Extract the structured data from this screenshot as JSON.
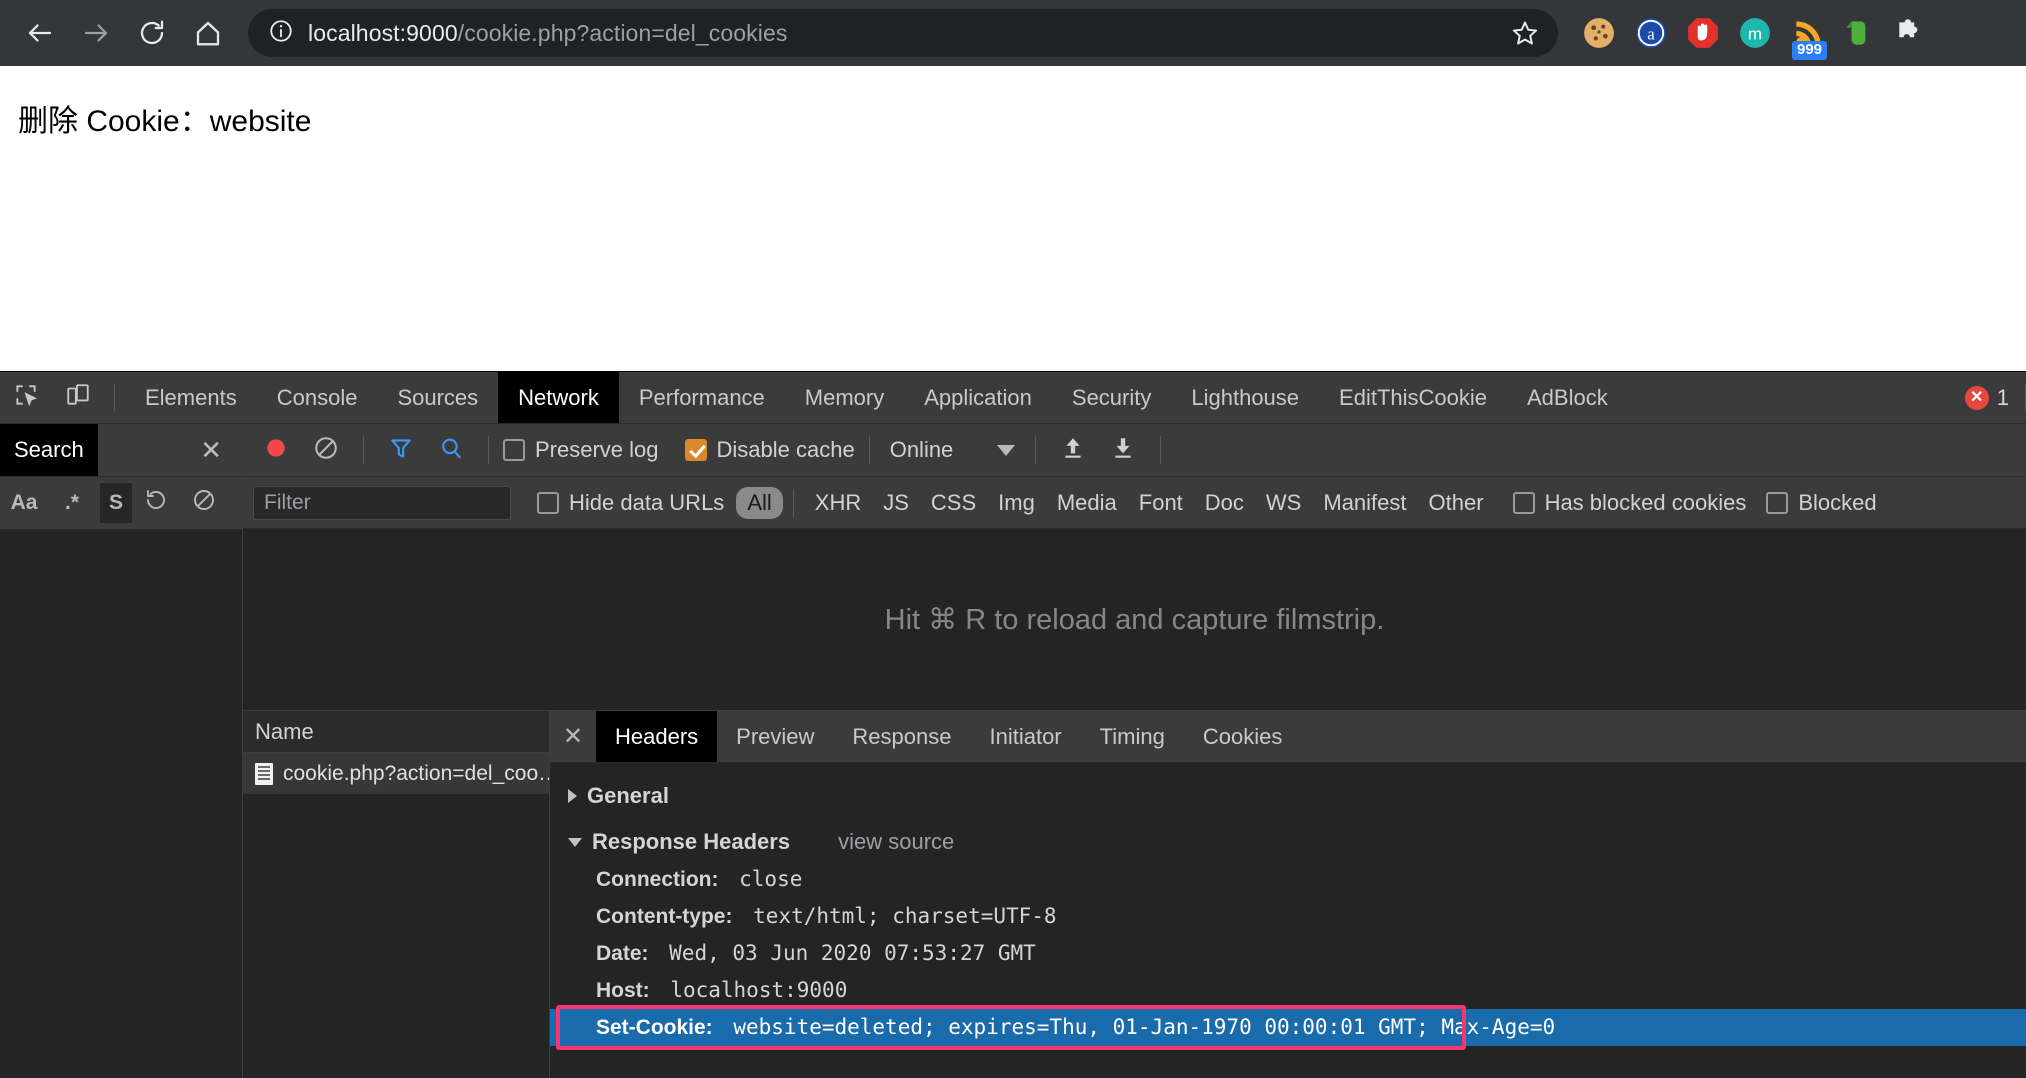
{
  "browser": {
    "nav": {
      "back_icon": "arrow-left-icon",
      "forward_icon": "arrow-right-icon",
      "reload_icon": "reload-icon",
      "home_icon": "home-icon"
    },
    "omnibox": {
      "info_icon": "info-circle-icon",
      "host": "localhost:9000",
      "path": "/cookie.php?action=del_cookies",
      "full_url": "localhost:9000/cookie.php?action=del_cookies",
      "star_icon": "star-outline-icon"
    },
    "extensions": [
      {
        "name": "cookie-extension-icon",
        "label": "Cookie"
      },
      {
        "name": "a-circle-extension-icon",
        "label": "a"
      },
      {
        "name": "adblock-stop-hand-icon",
        "label": "AdBlock"
      },
      {
        "name": "m-circle-extension-icon",
        "label": "m"
      },
      {
        "name": "rss-feed-extension-icon",
        "label": "RSS",
        "badge": "999"
      },
      {
        "name": "evernote-extension-icon",
        "label": "Evernote"
      },
      {
        "name": "puzzle-extensions-icon",
        "label": "Extensions"
      }
    ]
  },
  "page": {
    "heading": "删除 Cookie：website"
  },
  "devtools": {
    "toolbar_icons": {
      "inspect": "inspect-element-icon",
      "device": "device-toolbar-icon"
    },
    "tabs": [
      {
        "label": "Elements",
        "active": false
      },
      {
        "label": "Console",
        "active": false
      },
      {
        "label": "Sources",
        "active": false
      },
      {
        "label": "Network",
        "active": true
      },
      {
        "label": "Performance",
        "active": false
      },
      {
        "label": "Memory",
        "active": false
      },
      {
        "label": "Application",
        "active": false
      },
      {
        "label": "Security",
        "active": false
      },
      {
        "label": "Lighthouse",
        "active": false
      },
      {
        "label": "EditThisCookie",
        "active": false
      },
      {
        "label": "AdBlock",
        "active": false
      }
    ],
    "error_badge": {
      "icon": "error-icon",
      "count": "1"
    },
    "search_panel": {
      "title": "Search",
      "close_icon": "close-icon",
      "tools": [
        {
          "name": "match-case-button",
          "label": "Aa",
          "active": false
        },
        {
          "name": "regex-button",
          "label": ".*",
          "active": false
        },
        {
          "name": "search-scope-button",
          "label": "S",
          "active": true
        },
        {
          "name": "refresh-button",
          "label": "refresh-icon",
          "active": false
        },
        {
          "name": "clear-button",
          "label": "clear-icon",
          "active": false
        }
      ]
    },
    "network_toolbar": {
      "record_icon": "record-stop-icon",
      "clear_icon": "clear-icon",
      "filter_icon": "filter-funnel-icon",
      "search_icon": "search-icon",
      "preserve_log": {
        "label": "Preserve log",
        "checked": false
      },
      "disable_cache": {
        "label": "Disable cache",
        "checked": true
      },
      "throttle": {
        "value": "Online"
      },
      "import_icon": "import-har-icon",
      "export_icon": "export-har-icon"
    },
    "filter_toolbar": {
      "filter_placeholder": "Filter",
      "filter_value": "",
      "hide_data_urls": {
        "label": "Hide data URLs",
        "checked": false
      },
      "types": [
        {
          "label": "All",
          "active": true
        },
        {
          "label": "XHR",
          "active": false
        },
        {
          "label": "JS",
          "active": false
        },
        {
          "label": "CSS",
          "active": false
        },
        {
          "label": "Img",
          "active": false
        },
        {
          "label": "Media",
          "active": false
        },
        {
          "label": "Font",
          "active": false
        },
        {
          "label": "Doc",
          "active": false
        },
        {
          "label": "WS",
          "active": false
        },
        {
          "label": "Manifest",
          "active": false
        },
        {
          "label": "Other",
          "active": false
        }
      ],
      "has_blocked_cookies": {
        "label": "Has blocked cookies",
        "checked": false
      },
      "blocked": {
        "label": "Blocked",
        "checked": false
      }
    },
    "filmstrip": {
      "message": "Hit ⌘ R to reload and capture filmstrip."
    },
    "request_list": {
      "column_header": "Name",
      "rows": [
        {
          "icon": "document-icon",
          "name": "cookie.php?action=del_coo…",
          "selected": true
        }
      ]
    },
    "detail_panel": {
      "close_icon": "close-icon",
      "tabs": [
        {
          "label": "Headers",
          "active": true
        },
        {
          "label": "Preview",
          "active": false
        },
        {
          "label": "Response",
          "active": false
        },
        {
          "label": "Initiator",
          "active": false
        },
        {
          "label": "Timing",
          "active": false
        },
        {
          "label": "Cookies",
          "active": false
        }
      ],
      "sections": [
        {
          "title": "General",
          "expanded": false
        },
        {
          "title": "Response Headers",
          "expanded": true,
          "view_source": "view source"
        }
      ],
      "response_headers": [
        {
          "name": "Connection:",
          "value": "close",
          "selected": false
        },
        {
          "name": "Content-type:",
          "value": "text/html; charset=UTF-8",
          "selected": false
        },
        {
          "name": "Date:",
          "value": "Wed, 03 Jun 2020 07:53:27 GMT",
          "selected": false
        },
        {
          "name": "Host:",
          "value": "localhost:9000",
          "selected": false
        },
        {
          "name": "Set-Cookie:",
          "value": "website=deleted; expires=Thu, 01-Jan-1970 00:00:01 GMT; Max-Age=0",
          "selected": true
        }
      ]
    }
  },
  "colors": {
    "annotation": "#f6366e",
    "selection": "#1a6bab",
    "accent_checkbox": "#d8892a",
    "chrome_bg": "#35363a",
    "devtools_bg": "#242424"
  }
}
